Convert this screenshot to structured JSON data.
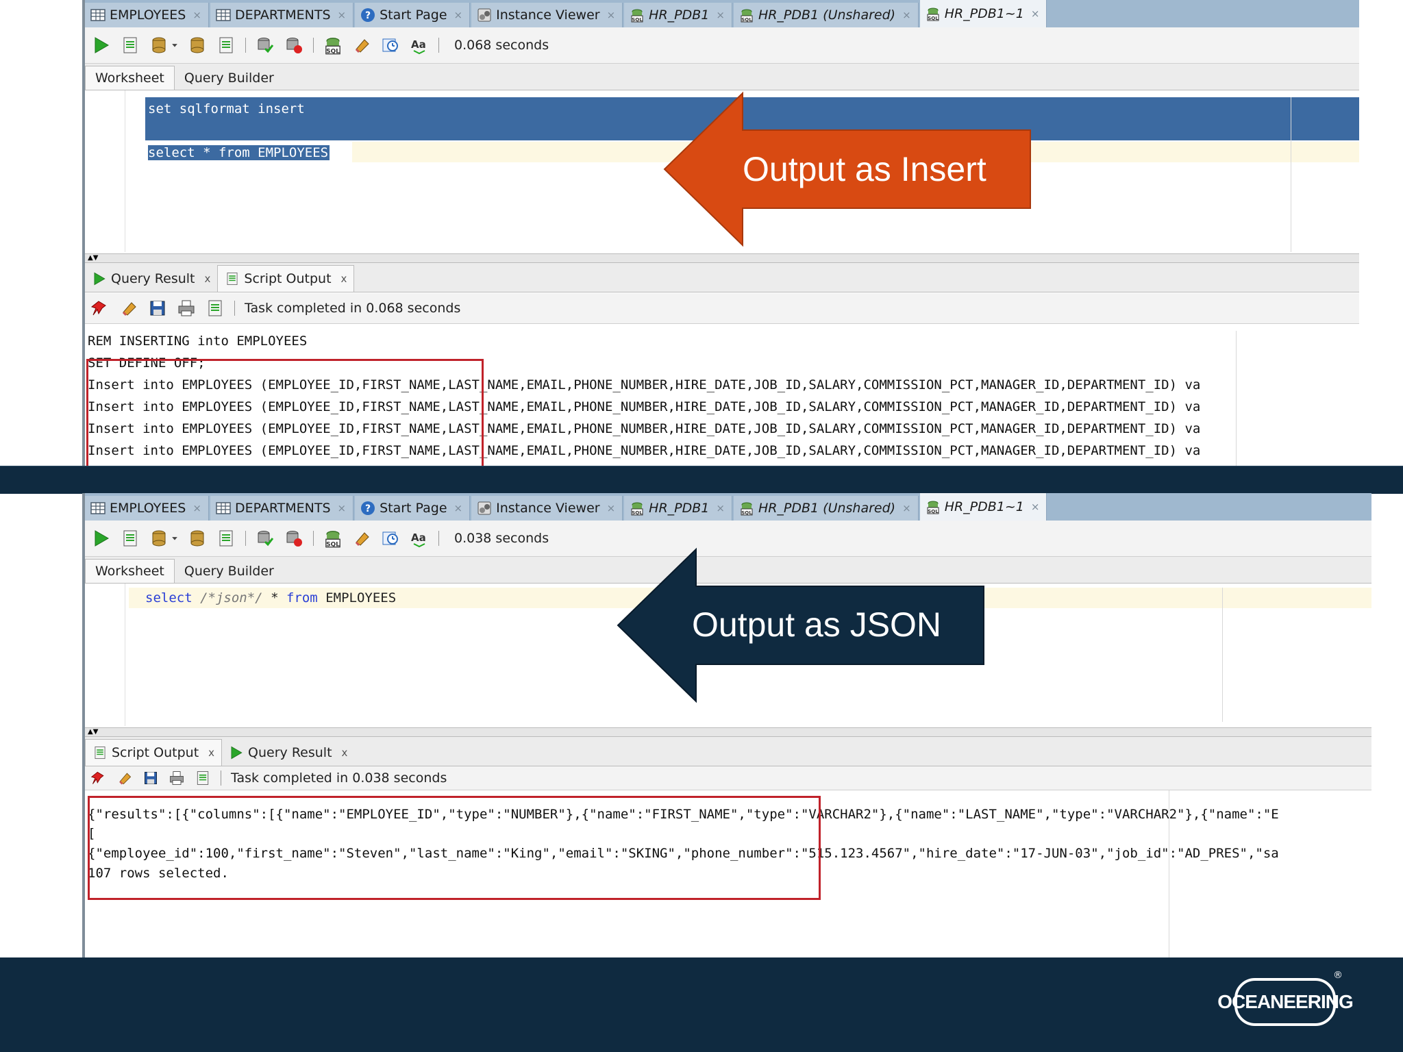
{
  "tabs": [
    {
      "label": "EMPLOYEES",
      "icon": "table-icon",
      "italic": false
    },
    {
      "label": "DEPARTMENTS",
      "icon": "table-icon",
      "italic": false
    },
    {
      "label": "Start Page",
      "icon": "help-icon",
      "italic": false
    },
    {
      "label": "Instance Viewer",
      "icon": "instance-viewer-icon",
      "italic": false
    },
    {
      "label": "HR_PDB1",
      "icon": "sql-worksheet-icon",
      "italic": true
    },
    {
      "label": "HR_PDB1 (Unshared)",
      "icon": "sql-worksheet-icon",
      "italic": true
    },
    {
      "label": "HR_PDB1~1",
      "icon": "sql-worksheet-icon",
      "italic": true
    }
  ],
  "tab_close": "×",
  "worksheet_tabs": {
    "worksheet": "Worksheet",
    "query_builder": "Query Builder"
  },
  "panel1": {
    "execution_time": "0.068 seconds",
    "sql_line1": "set sqlformat insert",
    "sql_line2": "select * from EMPLOYEES",
    "out_tab_query_result": "Query Result",
    "out_tab_script_output": "Script Output",
    "status": "Task completed in 0.068 seconds",
    "output_lines": [
      "REM INSERTING into EMPLOYEES",
      "SET DEFINE OFF;",
      "Insert into EMPLOYEES (EMPLOYEE_ID,FIRST_NAME,LAST_NAME,EMAIL,PHONE_NUMBER,HIRE_DATE,JOB_ID,SALARY,COMMISSION_PCT,MANAGER_ID,DEPARTMENT_ID) va",
      "Insert into EMPLOYEES (EMPLOYEE_ID,FIRST_NAME,LAST_NAME,EMAIL,PHONE_NUMBER,HIRE_DATE,JOB_ID,SALARY,COMMISSION_PCT,MANAGER_ID,DEPARTMENT_ID) va",
      "Insert into EMPLOYEES (EMPLOYEE_ID,FIRST_NAME,LAST_NAME,EMAIL,PHONE_NUMBER,HIRE_DATE,JOB_ID,SALARY,COMMISSION_PCT,MANAGER_ID,DEPARTMENT_ID) va",
      "Insert into EMPLOYEES (EMPLOYEE_ID,FIRST_NAME,LAST_NAME,EMAIL,PHONE_NUMBER,HIRE_DATE,JOB_ID,SALARY,COMMISSION_PCT,MANAGER_ID,DEPARTMENT_ID) va"
    ],
    "callout": "Output as Insert"
  },
  "panel2": {
    "execution_time": "0.038 seconds",
    "sql_select": "select",
    "sql_hint": "/*json*/",
    "sql_star": "*",
    "sql_from": "from",
    "sql_table": "EMPLOYEES",
    "out_tab_script_output": "Script Output",
    "out_tab_query_result": "Query Result",
    "status": "Task completed in 0.038 seconds",
    "output_lines": [
      "{\"results\":[{\"columns\":[{\"name\":\"EMPLOYEE_ID\",\"type\":\"NUMBER\"},{\"name\":\"FIRST_NAME\",\"type\":\"VARCHAR2\"},{\"name\":\"LAST_NAME\",\"type\":\"VARCHAR2\"},{\"name\":\"E",
      "[",
      "{\"employee_id\":100,\"first_name\":\"Steven\",\"last_name\":\"King\",\"email\":\"SKING\",\"phone_number\":\"515.123.4567\",\"hire_date\":\"17-JUN-03\",\"job_id\":\"AD_PRES\",\"sa",
      "107 rows selected."
    ],
    "callout": "Output as JSON"
  },
  "colors": {
    "callout_orange": "#d84a12",
    "callout_navy": "#0f2a40",
    "highlight_box": "#c0222a",
    "selection": "#3c6aa1"
  },
  "footer": {
    "logo": "OCEANEERING",
    "registered": "®"
  }
}
